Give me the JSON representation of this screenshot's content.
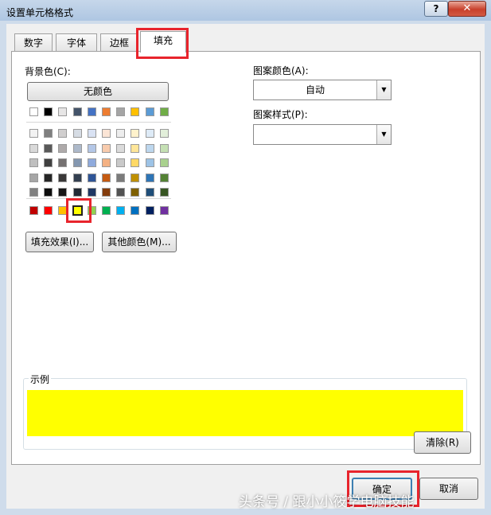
{
  "window": {
    "title": "设置单元格格式",
    "help_label": "?",
    "close_label": "✕"
  },
  "tabs": [
    {
      "label": "数字",
      "active": false
    },
    {
      "label": "字体",
      "active": false
    },
    {
      "label": "边框",
      "active": false
    },
    {
      "label": "填充",
      "active": true
    }
  ],
  "fill": {
    "background_color_label": "背景色(C):",
    "no_color_label": "无颜色",
    "theme_top_row": [
      "#ffffff",
      "#000000",
      "#e7e6e6",
      "#44546a",
      "#4472c4",
      "#ed7d31",
      "#a5a5a5",
      "#ffc000",
      "#5b9bd5",
      "#70ad47"
    ],
    "theme_shades": [
      [
        "#f2f2f2",
        "#7f7f7f",
        "#d0cece",
        "#d6dce4",
        "#d9e2f3",
        "#fbe5d6",
        "#ededed",
        "#fff2cc",
        "#deebf7",
        "#e2efda"
      ],
      [
        "#d9d9d9",
        "#595959",
        "#aeaaaa",
        "#adb9ca",
        "#b4c7e7",
        "#f8cbad",
        "#dbdbdb",
        "#ffe699",
        "#bdd7ee",
        "#c5e0b4"
      ],
      [
        "#bfbfbf",
        "#404040",
        "#757171",
        "#8497b0",
        "#8faadc",
        "#f4b183",
        "#c9c9c9",
        "#ffd966",
        "#9dc3e6",
        "#a9d18e"
      ],
      [
        "#a6a6a6",
        "#262626",
        "#3a3838",
        "#333f50",
        "#2f5597",
        "#c55a11",
        "#7b7b7b",
        "#bf9000",
        "#2e75b6",
        "#548235"
      ],
      [
        "#808080",
        "#0d0d0d",
        "#171616",
        "#222a35",
        "#1f3864",
        "#843c0c",
        "#525252",
        "#7f6000",
        "#1f4e79",
        "#375623"
      ]
    ],
    "standard_colors": [
      "#c00000",
      "#ff0000",
      "#ffc000",
      "#ffff00",
      "#92d050",
      "#00b050",
      "#00b0f0",
      "#0070c0",
      "#002060",
      "#7030a0"
    ],
    "selected_color": "#ffff00",
    "fill_effects_label": "填充效果(I)...",
    "more_colors_label": "其他颜色(M)...",
    "pattern_color_label": "图案颜色(A):",
    "pattern_color_value": "自动",
    "pattern_style_label": "图案样式(P):",
    "pattern_style_value": "",
    "sample_label": "示例",
    "clear_label": "清除(R)"
  },
  "footer": {
    "ok_label": "确定",
    "cancel_label": "取消"
  },
  "watermark": "头条号 / 跟小小筱学电脑技能"
}
